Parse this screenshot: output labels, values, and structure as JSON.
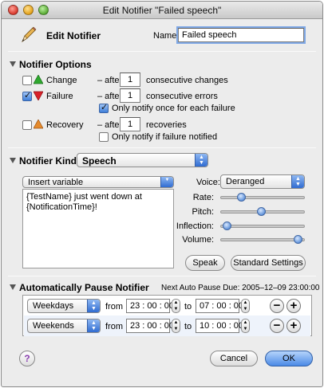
{
  "window": {
    "title": "Edit Notifier \"Failed speech\""
  },
  "header": {
    "title": "Edit Notifier",
    "name_label": "Name:",
    "name_value": "Failed speech"
  },
  "options": {
    "title": "Notifier Options",
    "change": {
      "label": "Change",
      "after": "– after",
      "count": "1",
      "suffix": "consecutive changes",
      "checked": false
    },
    "failure": {
      "label": "Failure",
      "after": "– after",
      "count": "1",
      "suffix": "consecutive errors",
      "checked": true,
      "sub_label": "Only notify once for each failure",
      "sub_checked": true
    },
    "recovery": {
      "label": "Recovery",
      "after": "– after",
      "count": "1",
      "suffix": "recoveries",
      "checked": false,
      "sub_label": "Only notify if failure notified",
      "sub_checked": false
    }
  },
  "kind": {
    "title": "Notifier Kind:",
    "value": "Speech",
    "insert_variable": "Insert variable",
    "message": "{TestName} just went down at {NotificationTime}!",
    "voice_label": "Voice:",
    "voice_value": "Deranged",
    "sliders": [
      {
        "label": "Rate:",
        "value": 0.22
      },
      {
        "label": "Pitch:",
        "value": 0.48
      },
      {
        "label": "Inflection:",
        "value": 0.03
      },
      {
        "label": "Volume:",
        "value": 0.97
      }
    ],
    "speak_button": "Speak",
    "standard_button": "Standard Settings"
  },
  "pause": {
    "title": "Automatically Pause Notifier",
    "next_label": "Next Auto Pause Due: 2005–12–09 23:00:00",
    "rows": [
      {
        "days": "Weekdays",
        "from_label": "from",
        "from_time": "23 : 00 : 00",
        "to_label": "to",
        "to_time": "07 : 00 : 00"
      },
      {
        "days": "Weekends",
        "from_label": "from",
        "from_time": "23 : 00 : 00",
        "to_label": "to",
        "to_time": "10 : 00 : 00"
      }
    ]
  },
  "footer": {
    "help": "?",
    "cancel": "Cancel",
    "ok": "OK"
  },
  "icons": {
    "change": "green-up-triangle-icon",
    "failure": "red-down-triangle-icon",
    "recovery": "orange-up-triangle-icon",
    "header": "pencil-icon"
  },
  "colors": {
    "change": "#2ea82e",
    "failure": "#d8222a",
    "recovery": "#e58a2c",
    "accent": "#3f7fd9"
  }
}
